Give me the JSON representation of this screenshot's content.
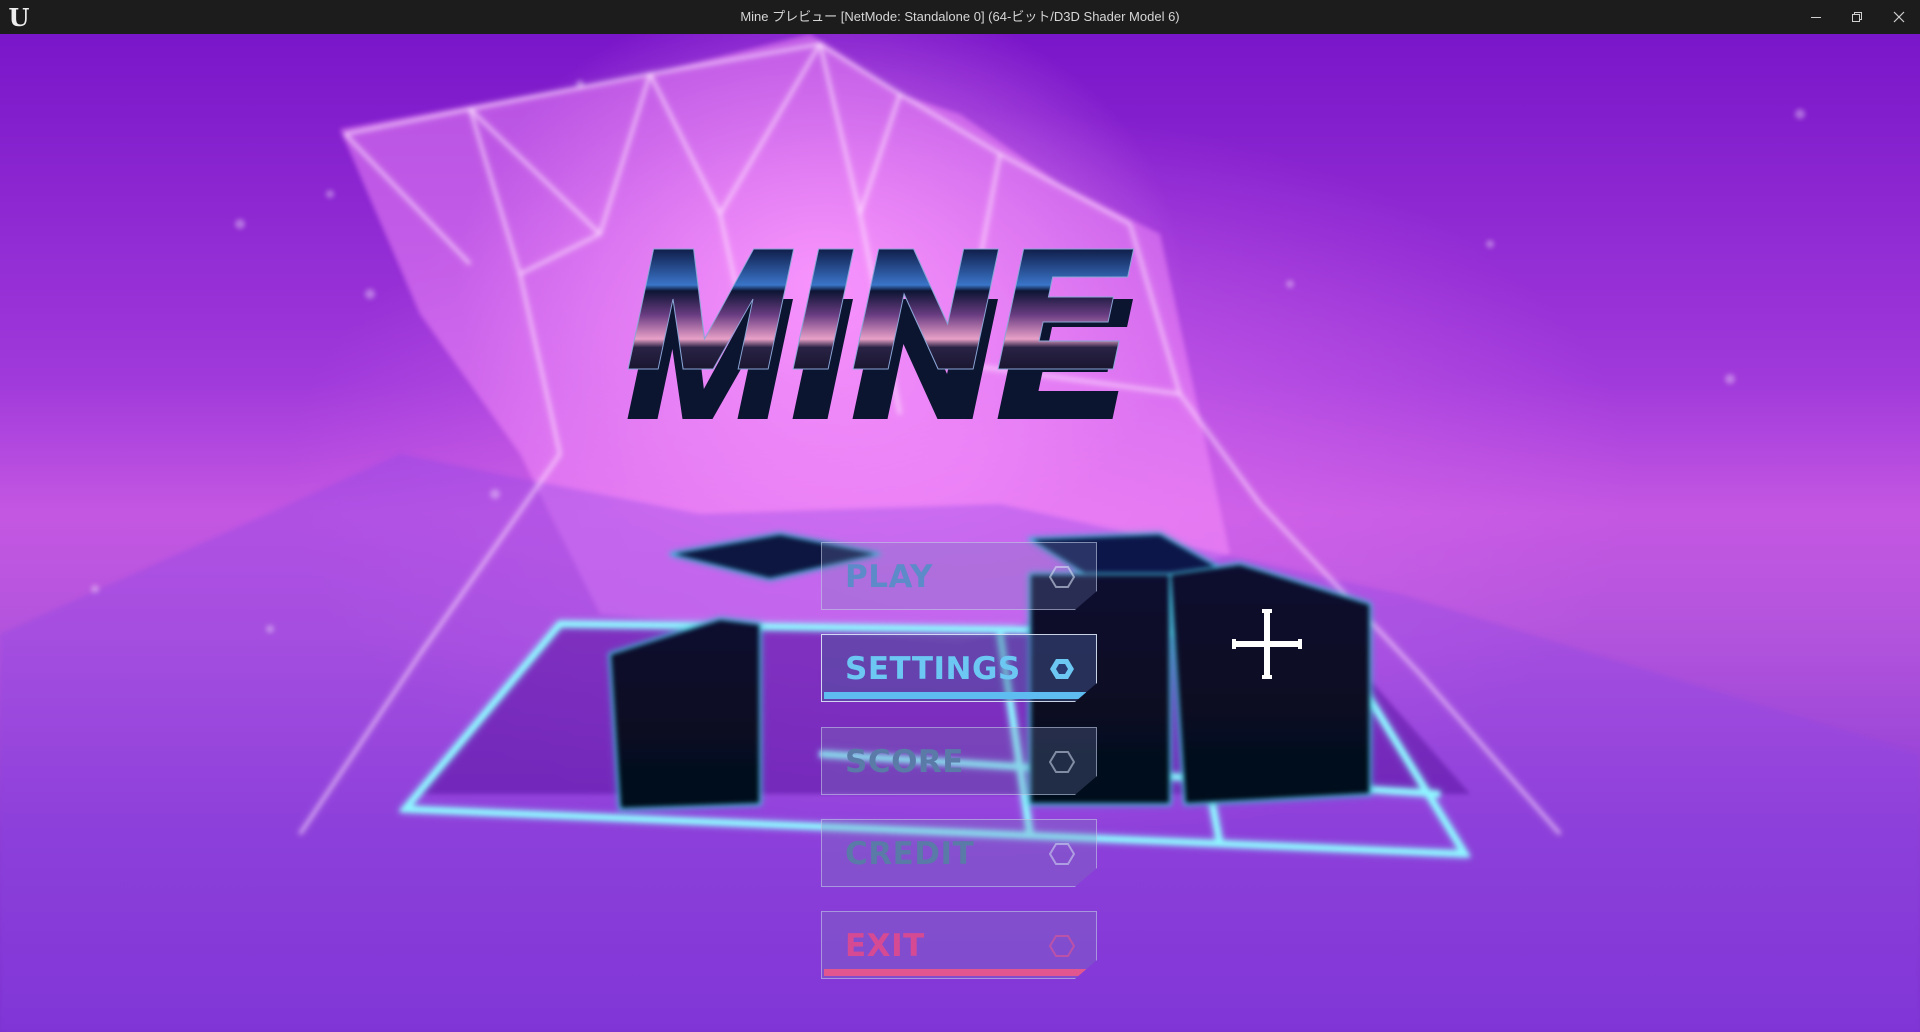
{
  "window": {
    "title": "Mine プレビュー [NetMode: Standalone 0]  (64-ビット/D3D Shader Model 6)",
    "logo_icon": "unreal-engine-logo",
    "controls": [
      "minimize-icon",
      "restore-icon",
      "close-icon"
    ]
  },
  "game": {
    "logo_text": "MINE",
    "menu": [
      {
        "label": "PLAY",
        "state": "normal"
      },
      {
        "label": "SETTINGS",
        "state": "selected"
      },
      {
        "label": "SCORE",
        "state": "disabled"
      },
      {
        "label": "CREDIT",
        "state": "disabled"
      },
      {
        "label": "EXIT",
        "state": "normal"
      }
    ]
  },
  "colors": {
    "sky_top": "#7a16c9",
    "glow_pink": "#ff9dff",
    "grid_cyan": "#8ff6ff",
    "selected_accent": "#5fbcf0",
    "exit_accent": "#e2568f"
  }
}
